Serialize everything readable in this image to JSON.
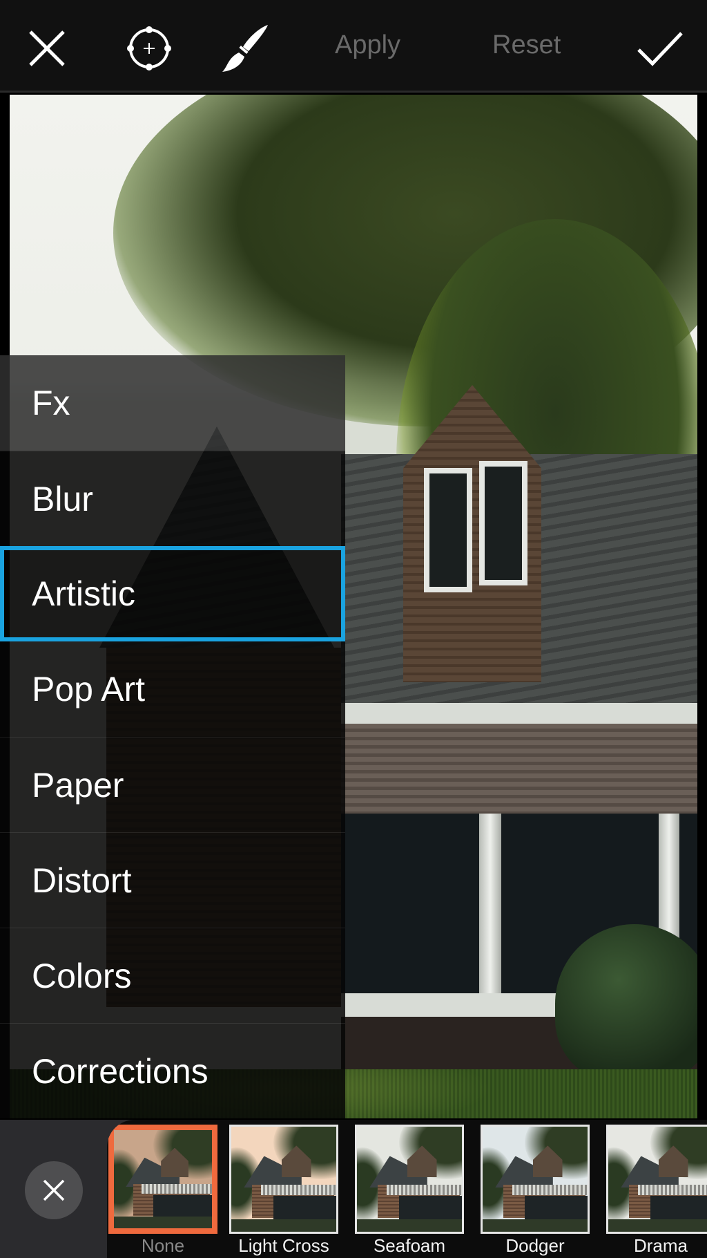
{
  "toolbar": {
    "close_icon": "close-icon",
    "target_icon": "crosshair-target-icon",
    "brush_icon": "paintbrush-icon",
    "apply_label": "Apply",
    "reset_label": "Reset",
    "confirm_icon": "checkmark-icon"
  },
  "menu": {
    "items": [
      {
        "label": "Fx",
        "selected": false
      },
      {
        "label": "Blur",
        "selected": false
      },
      {
        "label": "Artistic",
        "selected": true
      },
      {
        "label": "Pop Art",
        "selected": false
      },
      {
        "label": "Paper",
        "selected": false
      },
      {
        "label": "Distort",
        "selected": false
      },
      {
        "label": "Colors",
        "selected": false
      },
      {
        "label": "Corrections",
        "selected": false
      }
    ]
  },
  "filters": {
    "close_icon": "close-icon",
    "items": [
      {
        "label": "None",
        "selected": true,
        "tint": "#c8a58a"
      },
      {
        "label": "Light Cross",
        "selected": false,
        "tint": "#f3d6bd"
      },
      {
        "label": "Seafoam",
        "selected": false,
        "tint": "#e4e6e0"
      },
      {
        "label": "Dodger",
        "selected": false,
        "tint": "#dfe6e8"
      },
      {
        "label": "Drama",
        "selected": false,
        "tint": "#e6e7e2"
      }
    ]
  },
  "colors": {
    "selection_accent": "#1aa3e0",
    "selected_filter_border": "#ef6a3e",
    "toolbar_bg": "#111111",
    "disabled_text": "#6a6a6a"
  }
}
